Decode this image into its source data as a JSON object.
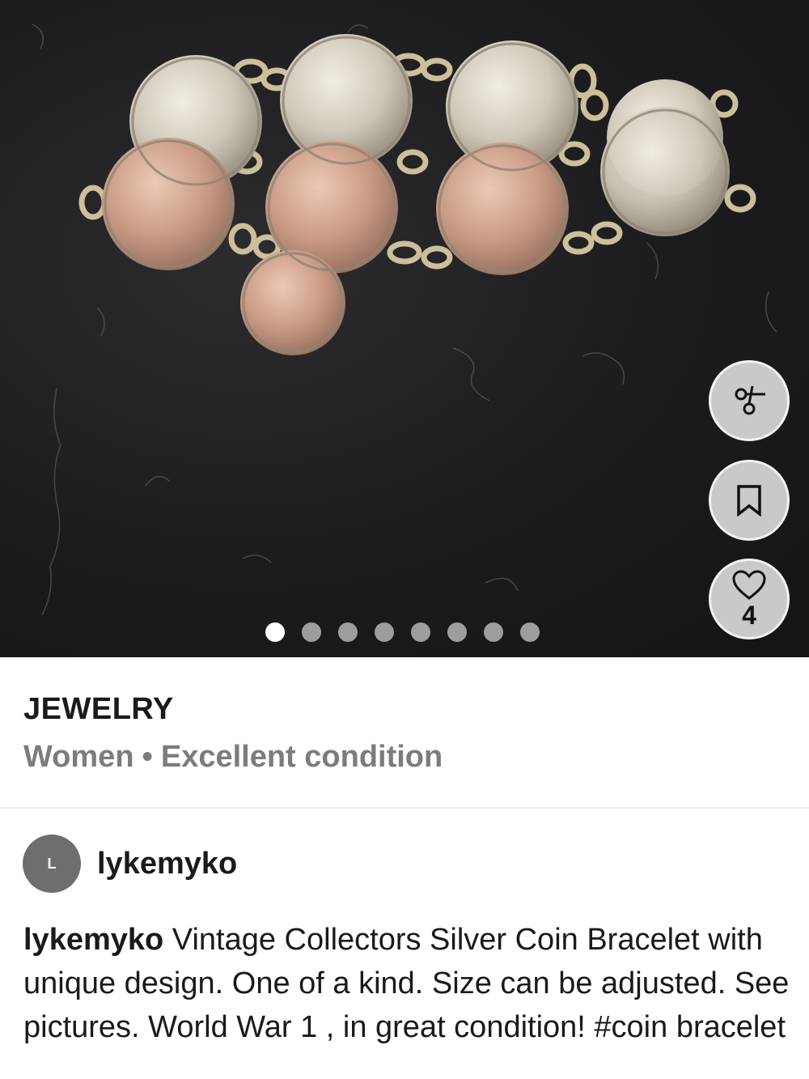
{
  "listing": {
    "category": "JEWELRY",
    "gender": "Women",
    "separator": "•",
    "condition": "Excellent condition"
  },
  "actions": {
    "share_icon": "scissors-icon",
    "save_icon": "bookmark-icon",
    "like_icon": "heart-icon",
    "like_count": "4"
  },
  "gallery": {
    "dots": 8,
    "active_index": 0
  },
  "seller": {
    "avatar_initial": "L",
    "username": "lykemyko"
  },
  "description": {
    "username": "lykemyko",
    "text": " Vintage Collectors Silver Coin Bracelet with unique design. One of a kind. Size can be adjusted. See pictures. World War 1 , in great condition!  #coin bracelet"
  },
  "colors": {
    "photo_background": "#1c1c1e",
    "fab_background": "#c9c9cb",
    "secondary_text": "#7c7c7c"
  }
}
